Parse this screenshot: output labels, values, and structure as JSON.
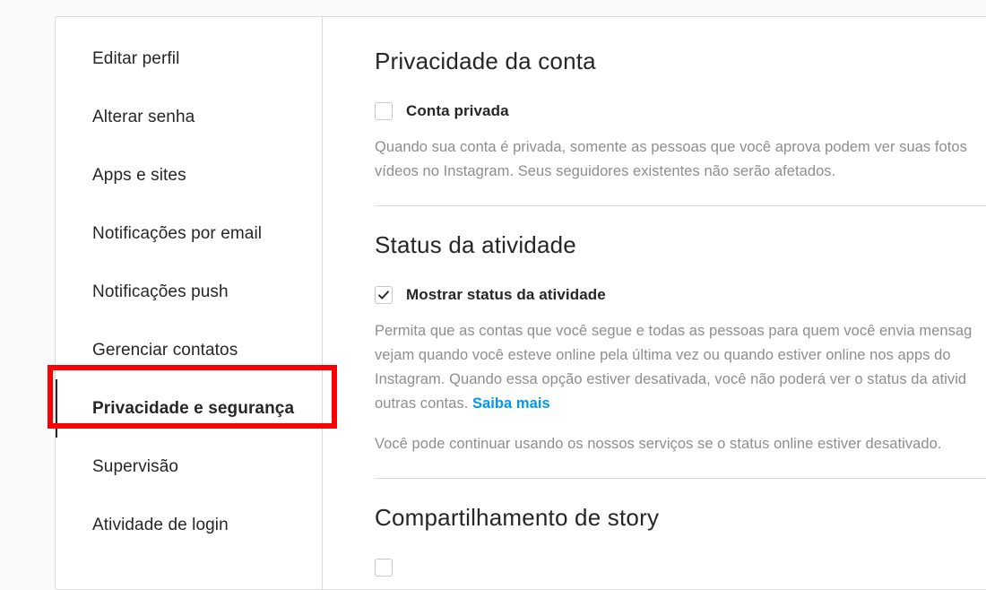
{
  "sidebar": {
    "items": [
      {
        "label": "Editar perfil",
        "active": false
      },
      {
        "label": "Alterar senha",
        "active": false
      },
      {
        "label": "Apps e sites",
        "active": false
      },
      {
        "label": "Notificações por email",
        "active": false
      },
      {
        "label": "Notificações push",
        "active": false
      },
      {
        "label": "Gerenciar contatos",
        "active": false
      },
      {
        "label": "Privacidade e segurança",
        "active": true
      },
      {
        "label": "Supervisão",
        "active": false
      },
      {
        "label": "Atividade de login",
        "active": false
      }
    ]
  },
  "highlight": {
    "color": "#fb0007",
    "target": "Privacidade e segurança"
  },
  "content": {
    "section_account_privacy": {
      "title": "Privacidade da conta",
      "checkbox_label": "Conta privada",
      "checked": false,
      "description_line1": "Quando sua conta é privada, somente as pessoas que você aprova podem ver suas fotos",
      "description_line2": "vídeos no Instagram. Seus seguidores existentes não serão afetados."
    },
    "section_activity_status": {
      "title": "Status da atividade",
      "checkbox_label": "Mostrar status da atividade",
      "checked": true,
      "description_line1": "Permita que as contas que você segue e todas as pessoas para quem você envia mensag",
      "description_line2": "vejam quando você esteve online pela última vez ou quando estiver online nos apps do",
      "description_line3": "Instagram. Quando essa opção estiver desativada, você não poderá ver o status da ativid",
      "description_line4_prefix": "outras contas. ",
      "link_label": "Saiba mais",
      "footer_note": "Você pode continuar usando os nossos serviços se o status online estiver desativado."
    },
    "section_story_sharing": {
      "title": "Compartilhamento de story"
    }
  },
  "colors": {
    "page_background": "#fafafa",
    "card_background": "#ffffff",
    "border": "#dbdbdb",
    "text_primary": "#262626",
    "text_secondary": "#8e8e8e",
    "link": "#0095f6",
    "highlight": "#fb0007"
  }
}
